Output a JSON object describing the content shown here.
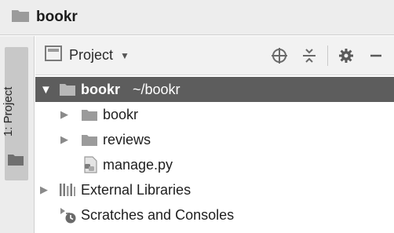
{
  "breadcrumb": {
    "label": "bookr"
  },
  "toolstrip": {
    "tab_label": "1: Project"
  },
  "panel": {
    "title": "Project"
  },
  "tree": {
    "root": {
      "label": "bookr",
      "path": "~/bookr"
    },
    "children": [
      {
        "label": "bookr"
      },
      {
        "label": "reviews"
      },
      {
        "label": "manage.py"
      }
    ],
    "external_libraries": "External Libraries",
    "scratches": "Scratches and Consoles"
  },
  "colors": {
    "selection": "#5d5d5d",
    "folder": "#9b9b9b",
    "toolbar_bg": "#ededed"
  },
  "icons": [
    "folder-icon",
    "chevron-down-icon",
    "locate-icon",
    "collapse-all-icon",
    "gear-icon",
    "minimize-icon",
    "python-file-icon",
    "libraries-icon",
    "scratches-icon"
  ]
}
